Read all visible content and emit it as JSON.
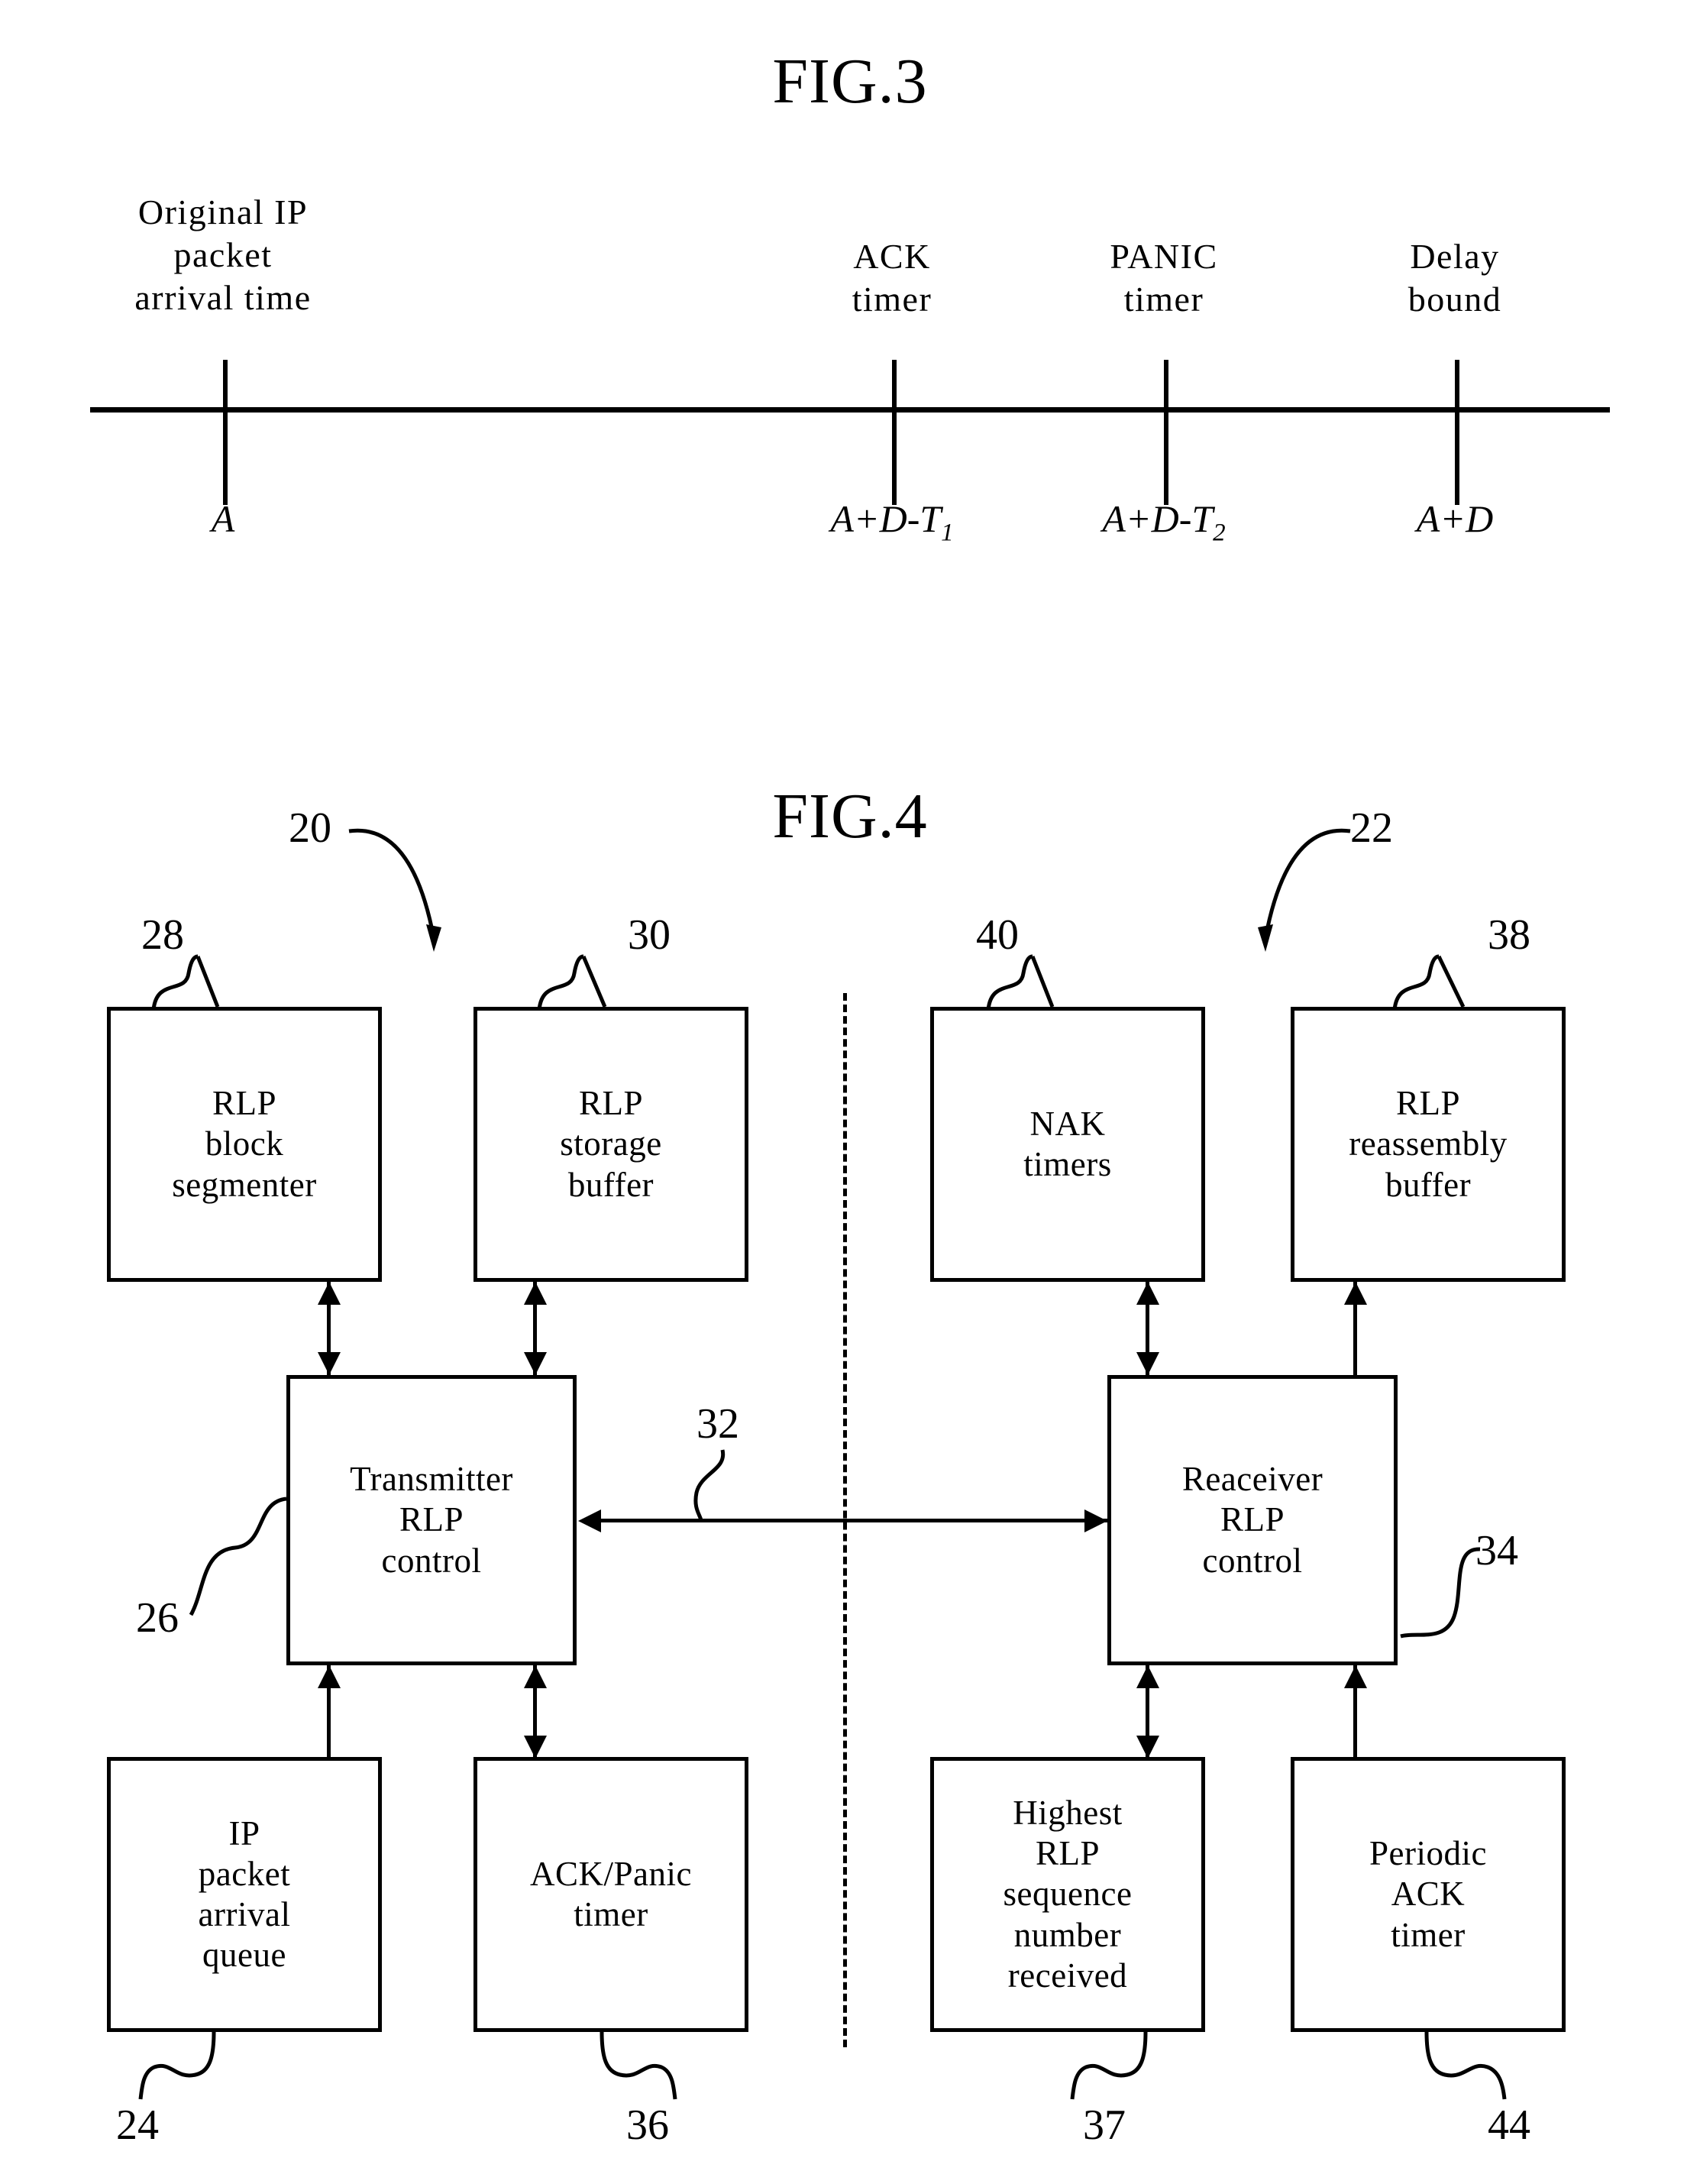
{
  "figures": [
    {
      "id": "fig3",
      "title": "FIG.3",
      "type": "timeline",
      "timeline": {
        "events": [
          {
            "top_label": "Original  IP\npacket\narrival  time",
            "bottom_label": "A",
            "bottom_sub": ""
          },
          {
            "top_label": "ACK\ntimer",
            "bottom_label": "A+D-T",
            "bottom_sub": "1"
          },
          {
            "top_label": "PANIC\ntimer",
            "bottom_label": "A+D-T",
            "bottom_sub": "2"
          },
          {
            "top_label": "Delay\nbound",
            "bottom_label": "A+D",
            "bottom_sub": ""
          }
        ]
      }
    },
    {
      "id": "fig4",
      "title": "FIG.4",
      "type": "block-diagram",
      "blocks": [
        {
          "key": "rlp_block_segmenter",
          "label": "RLP\nblock\nsegmenter",
          "ref": "28"
        },
        {
          "key": "rlp_storage_buffer",
          "label": "RLP\nstorage\nbuffer",
          "ref": "30"
        },
        {
          "key": "nak_timers",
          "label": "NAK\ntimers",
          "ref": "40"
        },
        {
          "key": "rlp_reassembly_buffer",
          "label": "RLP\nreassembly\nbuffer",
          "ref": "38"
        },
        {
          "key": "transmitter_rlp_control",
          "label": "Transmitter\nRLP\ncontrol",
          "ref": "26"
        },
        {
          "key": "receiver_rlp_control",
          "label": "Reaceiver\nRLP\ncontrol",
          "ref": "34"
        },
        {
          "key": "ip_packet_arrival_queue",
          "label": "IP\npacket\narrival\nqueue",
          "ref": "24"
        },
        {
          "key": "ack_panic_timer",
          "label": "ACK/Panic\ntimer",
          "ref": "36"
        },
        {
          "key": "highest_rlp_seq_received",
          "label": "Highest\nRLP\nsequence\nnumber\nreceived",
          "ref": "37"
        },
        {
          "key": "periodic_ack_timer",
          "label": "Periodic\nACK\ntimer",
          "ref": "44"
        }
      ],
      "section_refs": [
        {
          "key": "transmitter_section",
          "ref": "20"
        },
        {
          "key": "receiver_section",
          "ref": "22"
        }
      ],
      "link_refs": [
        {
          "key": "control_link",
          "ref": "32"
        }
      ]
    }
  ],
  "colors": {
    "ink": "#000000",
    "paper": "#ffffff"
  }
}
